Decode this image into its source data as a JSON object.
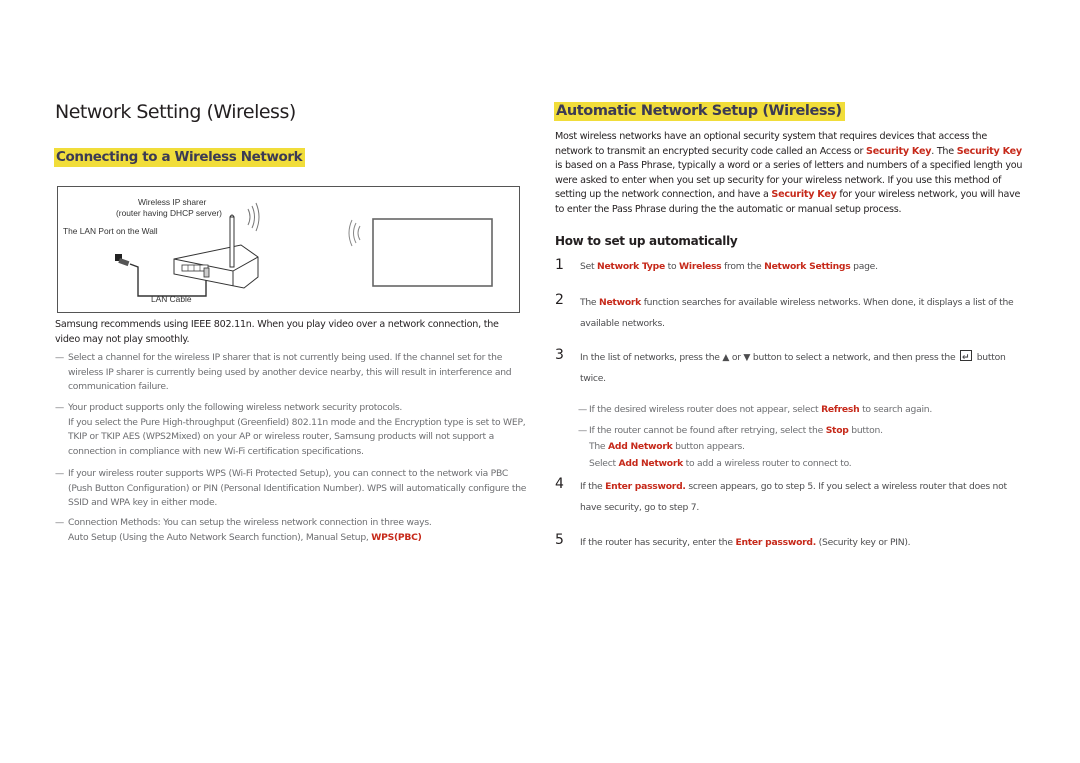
{
  "left": {
    "page_title": "Network Setting (Wireless)",
    "section_title": "Connecting to a Wireless Network",
    "diagram": {
      "router_label_line1": "Wireless IP sharer",
      "router_label_line2": "(router having DHCP server)",
      "wall_port_label": "The LAN Port on the Wall",
      "cable_label": "LAN Cable"
    },
    "intro": "Samsung recommends using IEEE 802.11n. When you play video over a network connection, the video may not play smoothly.",
    "notes": [
      {
        "text": "Select a channel for the wireless IP sharer that is not currently being used. If the channel set for the wireless IP sharer is currently being used by another device nearby, this will result in interference and communication failure."
      },
      {
        "text": "Your product supports only the following wireless network security protocols.",
        "extra": "If you select the Pure High-throughput (Greenfield) 802.11n mode and the Encryption type is set to WEP, TKIP or TKIP AES (WPS2Mixed) on your AP or wireless router, Samsung products will not support a connection in compliance with new Wi-Fi certification specifications."
      },
      {
        "text": "If your wireless router supports WPS (Wi-Fi Protected Setup), you can connect to the network via PBC (Push Button Configuration) or PIN (Personal Identification Number). WPS will automatically configure the SSID and WPA key in either mode."
      },
      {
        "text": "Connection Methods: You can setup the wireless network connection in three ways.",
        "extra_prefix": "Auto Setup (Using the Auto Network Search function), Manual Setup, ",
        "extra_highlight": "WPS(PBC)"
      }
    ]
  },
  "right": {
    "section_title": "Automatic Network Setup (Wireless)",
    "intro": {
      "p1": "Most wireless networks have an optional security system that requires devices that access the network to transmit an encrypted security code called an Access or ",
      "k1": "Security Key",
      "p2": ". The ",
      "k2": "Security Key",
      "p3": " is based on a Pass Phrase, typically a word or a series of letters and numbers of a specified length you were asked to enter when you set up security for your wireless network. If you use this method of setting up the network connection, and have a ",
      "k3": "Security Key",
      "p4": " for your wireless network, you will have to enter the Pass Phrase during the the automatic or manual setup process."
    },
    "subheading": "How to set up automatically",
    "steps": [
      {
        "num": "1",
        "t1": "Set ",
        "k1": "Network Type",
        "t2": " to ",
        "k2": "Wireless",
        "t3": " from the ",
        "k3": "Network Settings",
        "t4": " page."
      },
      {
        "num": "2",
        "t1": "The ",
        "k1": "Network",
        "t2": " function searches for available wireless networks. When done, it displays a list of the available networks."
      },
      {
        "num": "3",
        "t1": "In the list of networks, press the ▲ or ▼ button to select a network, and then press the ",
        "icon": "enter-icon",
        "t2": " button twice."
      },
      {
        "num": "4",
        "t1": "If the ",
        "k1": "Enter password.",
        "t2": " screen appears, go to step 5. If you select a wireless router that does not have security, go to step 7."
      },
      {
        "num": "5",
        "t1": "If the router has security, enter the ",
        "k1": "Enter password.",
        "t2": " (Security key or PIN)."
      }
    ],
    "step3_notes": [
      {
        "t1": "If the desired wireless router does not appear, select ",
        "k1": "Refresh",
        "t2": " to search again."
      },
      {
        "t1": "If the router cannot be found after retrying, select the ",
        "k1": "Stop",
        "t2": " button."
      }
    ],
    "step3_note_extra": [
      {
        "t1": "The ",
        "k1": "Add Network",
        "t2": " button appears."
      },
      {
        "t1": "Select ",
        "k1": "Add Network",
        "t2": " to add a wireless router to connect to."
      }
    ]
  },
  "colors": {
    "highlight": "#f1dd3a",
    "keyword": "#c6291a",
    "heading_text": "#3b3a54",
    "note_text": "#6d6e71"
  }
}
